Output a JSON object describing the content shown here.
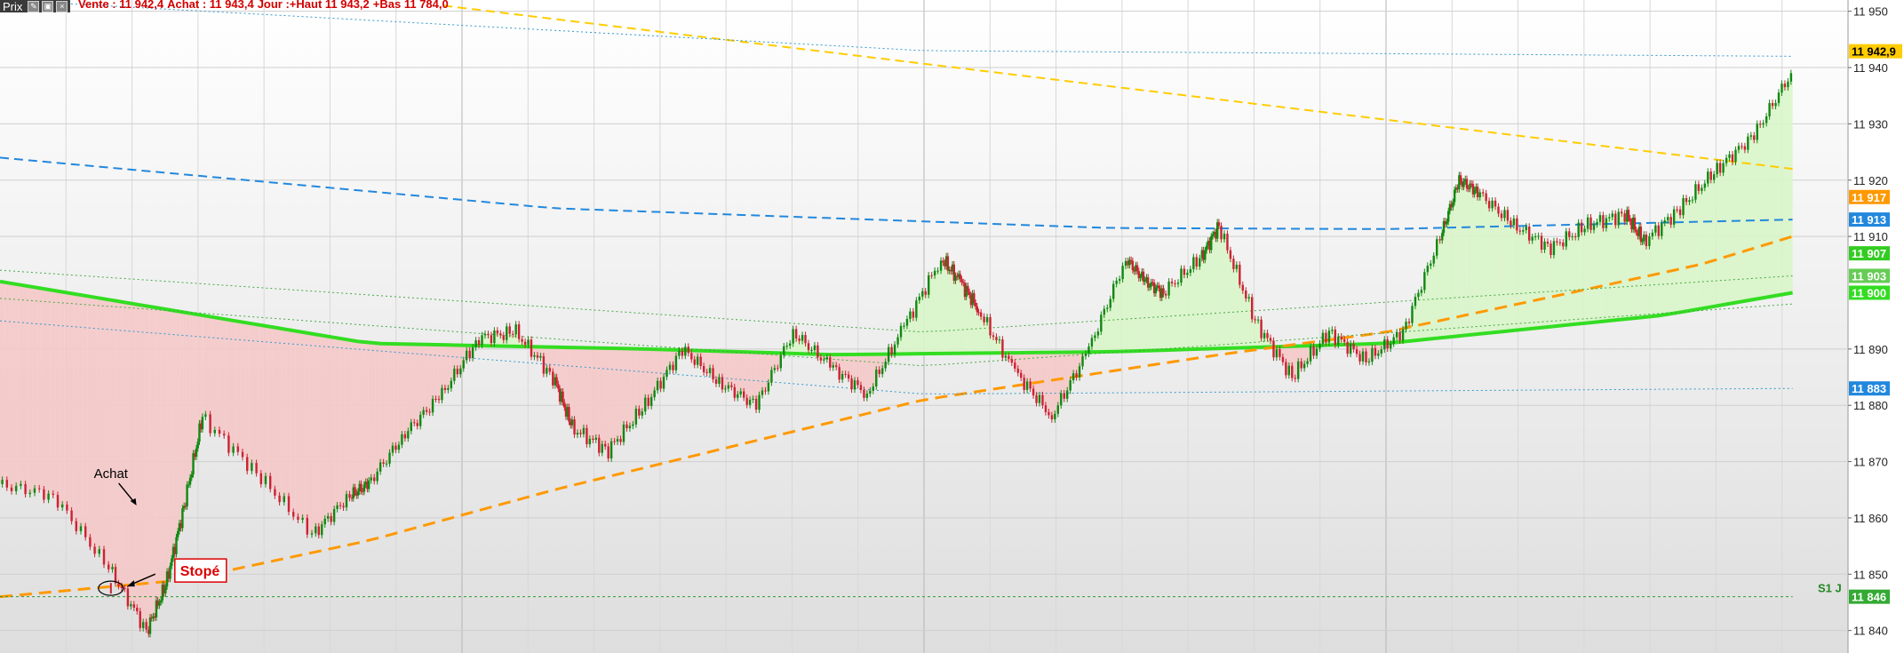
{
  "toolbar": {
    "label": "Prix",
    "icons": [
      "pencil-icon",
      "settings-icon",
      "close-icon"
    ]
  },
  "quote_line": {
    "vente": "Vente : 11 942,4",
    "achat": "Achat : 11 943,4",
    "haut": "Jour :+Haut 11 943,2",
    "bas": "+Bas 11 784,0"
  },
  "annotations": {
    "buy_label": "Achat",
    "stop_label": "Stopé",
    "pivot_label": "S1 J"
  },
  "colors": {
    "green_ma": "#33dd22",
    "orange_ma": "#ff9900",
    "yellow_trend": "#ffcc00",
    "blue_dashed": "#2288dd",
    "dotted_blue": "#3399cc",
    "dotted_green": "#44aa44",
    "candle_up": "#118811",
    "candle_down": "#cc2233",
    "fill_above": "#d8f5c8",
    "fill_below": "#f5c8c8",
    "badge_price": "#ffcc00",
    "stop_text": "#dd0000"
  },
  "chart_data": {
    "type": "line",
    "title": "",
    "ylim": [
      11836,
      11952
    ],
    "y_ticks": [
      11950,
      11940,
      11930,
      11920,
      11910,
      11890,
      11880,
      11870,
      11860,
      11850,
      11840
    ],
    "grid": true,
    "price_series": {
      "name": "Prix",
      "x": [
        0,
        3,
        6,
        8,
        9,
        10,
        11,
        14,
        17,
        19,
        20,
        22,
        24,
        26,
        28,
        30,
        31,
        33,
        35,
        37,
        39,
        41,
        43,
        45,
        47,
        49,
        51,
        52,
        53,
        55,
        57,
        59,
        61,
        62,
        63,
        65,
        66,
        68,
        70,
        72,
        74,
        76,
        78,
        79,
        80,
        82,
        84,
        86,
        88,
        89,
        91,
        93,
        95,
        97
      ],
      "values": [
        11866,
        11864,
        11851,
        11840,
        11848,
        11862,
        11878,
        11868,
        11857,
        11864,
        11866,
        11875,
        11882,
        11892,
        11893,
        11885,
        11876,
        11872,
        11880,
        11890,
        11884,
        11880,
        11893,
        11887,
        11882,
        11894,
        11906,
        11902,
        11897,
        11886,
        11878,
        11890,
        11906,
        11902,
        11900,
        11906,
        11912,
        11895,
        11885,
        11893,
        11888,
        11893,
        11910,
        11920,
        11918,
        11912,
        11908,
        11912,
        11914,
        11909,
        11915,
        11922,
        11928,
        11939
      ]
    },
    "lines": [
      {
        "name": "green-ma",
        "x": [
          0,
          20,
          35,
          45,
          60,
          75,
          90,
          97
        ],
        "values": [
          11902,
          11891,
          11890,
          11889,
          11889.5,
          11891,
          11896,
          11900
        ]
      },
      {
        "name": "orange-ma",
        "x": [
          0,
          10,
          20,
          30,
          40,
          50,
          60,
          66,
          75,
          85,
          92,
          97
        ],
        "values": [
          11846,
          11849,
          11856,
          11865,
          11873,
          11881,
          11886,
          11889,
          11893,
          11900,
          11905,
          11910
        ]
      },
      {
        "name": "yellow-trendline",
        "x": [
          24,
          97
        ],
        "values": [
          11951,
          11922
        ]
      },
      {
        "name": "blue-dashed",
        "x": [
          0,
          30,
          60,
          75,
          97
        ],
        "values": [
          11924,
          11915,
          11911.5,
          11911.3,
          11913
        ]
      },
      {
        "name": "dotted-upper-blue",
        "x": [
          0,
          50,
          97
        ],
        "values": [
          11952,
          11943,
          11942
        ]
      },
      {
        "name": "dotted-lower-blue",
        "x": [
          0,
          50,
          97
        ],
        "values": [
          11895,
          11882,
          11883
        ]
      },
      {
        "name": "dotted-green-upper",
        "x": [
          0,
          50,
          97
        ],
        "values": [
          11904,
          11893,
          11903
        ]
      },
      {
        "name": "dotted-green-lower",
        "x": [
          0,
          50,
          97
        ],
        "values": [
          11899,
          11887,
          11898
        ]
      },
      {
        "name": "pivot-s1",
        "x": [
          0,
          97
        ],
        "values": [
          11846,
          11846
        ]
      }
    ],
    "price_badges": [
      {
        "value": "11 942,9",
        "color": "#ffcc00"
      },
      {
        "value": "11 917",
        "color": "#ff9900"
      },
      {
        "value": "11 913",
        "color": "#2288dd"
      },
      {
        "value": "11 907",
        "color": "#33cc22"
      },
      {
        "value": "11 903",
        "color": "#66cc55"
      },
      {
        "value": "11 900",
        "color": "#33dd22"
      },
      {
        "value": "11 883",
        "color": "#2288dd"
      },
      {
        "value": "11 846",
        "color": "#33aa33"
      }
    ]
  }
}
